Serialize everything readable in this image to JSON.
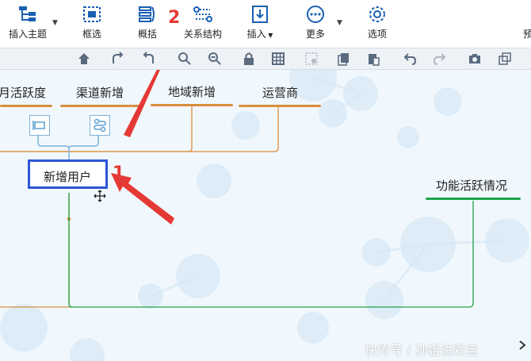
{
  "ribbon": {
    "insert_topic": "插入主题",
    "select": "框选",
    "summary": "概括",
    "relationship": "关系结构",
    "insert": "插入",
    "more": "更多",
    "options": "选项",
    "partial": "预"
  },
  "topics": {
    "activity": "月活跃度",
    "channel": "渠道新增",
    "region": "地域新增",
    "carrier": "运营商",
    "new_users": "新增用户",
    "feature": "功能活跃情况"
  },
  "annotations": {
    "n1": "1",
    "n2": "2"
  },
  "watermark": "快传号 / 孙姐说彩宝",
  "colors": {
    "accent": "#1a5fb4",
    "topic_line": "#d98e3d",
    "green_line": "#1fa34a",
    "arrow": "#e53935"
  }
}
